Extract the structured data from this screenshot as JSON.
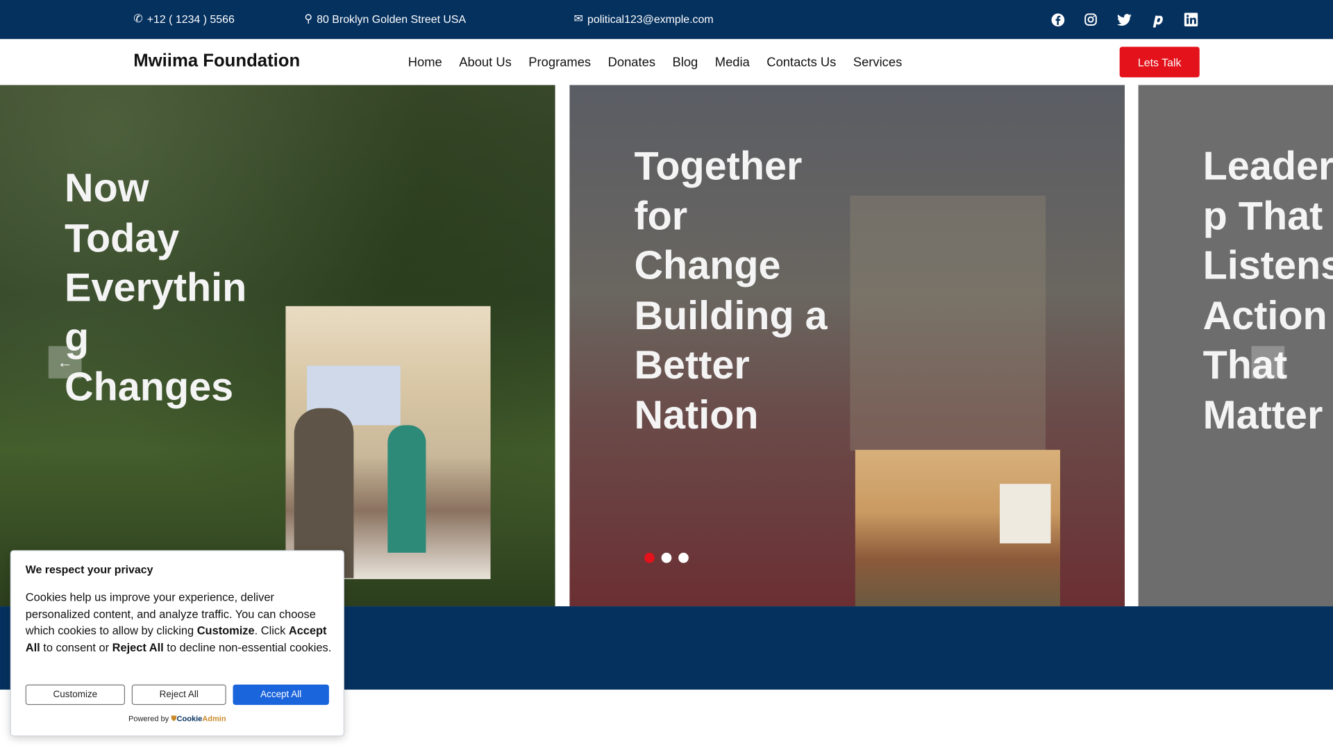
{
  "topbar": {
    "phone": "+12 ( 1234 ) 5566",
    "address": "80 Broklyn Golden Street USA",
    "email": "political123@exmple.com",
    "social": [
      "facebook-icon",
      "instagram-icon",
      "twitter-icon",
      "pinterest-icon",
      "linkedin-icon"
    ]
  },
  "nav": {
    "logo": "Mwiima Foundation",
    "items": [
      "Home",
      "About Us",
      "Programes",
      "Donates",
      "Blog",
      "Media",
      "Contacts Us",
      "Services"
    ],
    "cta": "Lets Talk"
  },
  "hero": {
    "slides": [
      {
        "lines": [
          "Now",
          "Today",
          "Everythin",
          "g",
          "Changes"
        ]
      },
      {
        "lines": [
          "Together",
          "for",
          "Change",
          "Building a",
          "Better",
          "Nation"
        ]
      },
      {
        "lines": [
          "Leader",
          "p That",
          "Listens",
          "Action",
          "That",
          "Matter"
        ]
      }
    ],
    "active_dot": 0,
    "dot_count": 3
  },
  "cookie": {
    "title": "We respect your privacy",
    "body_1": "Cookies help us improve your experience, deliver personalized content, and analyze traffic. You can choose which cookies to allow by clicking ",
    "b1": "Customize",
    "body_2": ". Click ",
    "b2": "Accept All",
    "body_3": " to consent or ",
    "b3": "Reject All",
    "body_4": " to decline non-essential cookies.",
    "customize": "Customize",
    "reject": "Reject All",
    "accept": "Accept All",
    "powered": "Powered by",
    "brand_a": "Cookie",
    "brand_b": "Admin"
  },
  "colors": {
    "navy": "#05315f",
    "red": "#e3121b",
    "accept": "#1a64dc"
  }
}
